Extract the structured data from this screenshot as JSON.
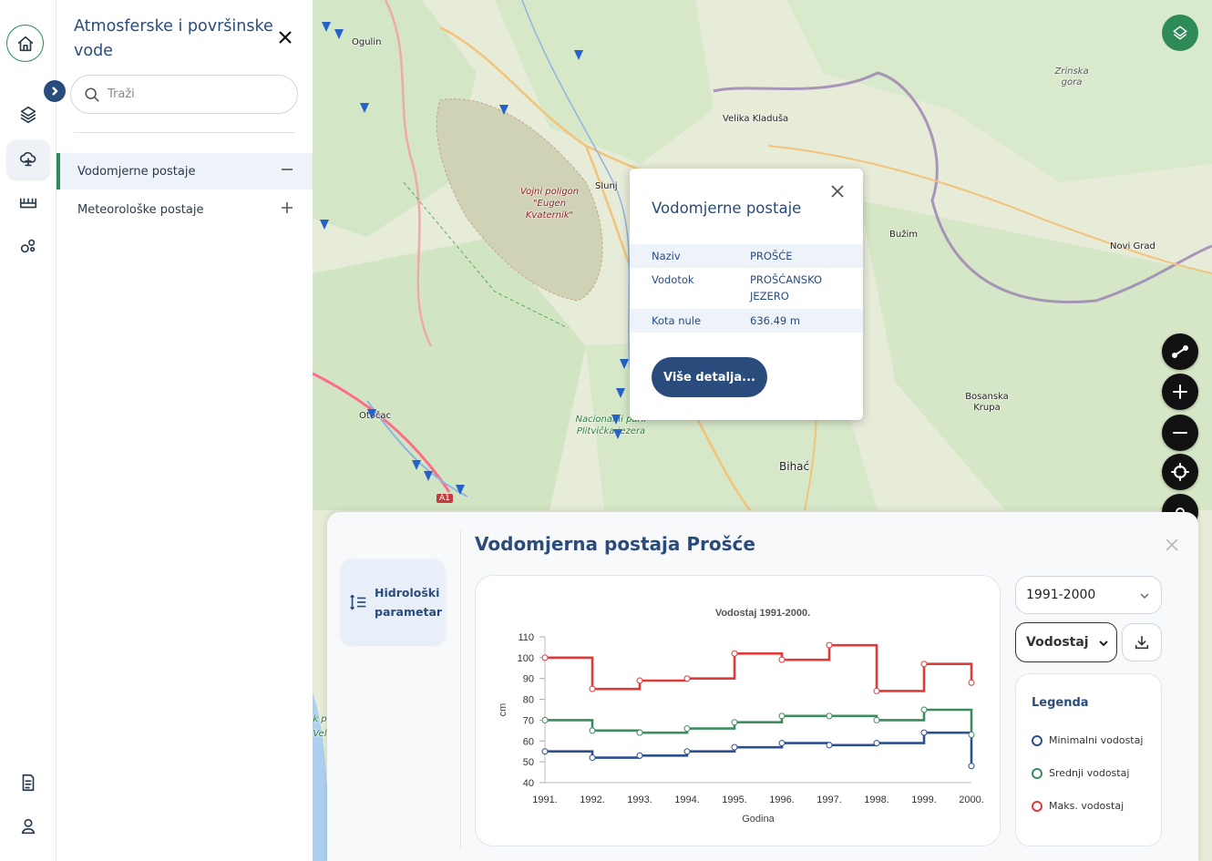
{
  "sidebar_rail": {
    "items": [
      "home-icon",
      "layers-icon",
      "weather-icon",
      "bridge-icon",
      "bubbles-icon",
      "document-icon",
      "user-icon"
    ]
  },
  "panel": {
    "title": "Atmosferske i površinske vode",
    "search_placeholder": "Traži",
    "categories": [
      {
        "label": "Vodomjerne postaje",
        "expanded": true
      },
      {
        "label": "Meteorološke postaje",
        "expanded": false
      }
    ]
  },
  "map": {
    "places": {
      "ogulin": "Ogulin",
      "velika_kladusa": "Velika Kladuša",
      "zrinska_gora": "Zrinska gora",
      "slunj": "Slunj",
      "vojni_poligon": "Vojni poligon \"Eugen Kvaternik\"",
      "buzim": "Bužim",
      "novi_grad": "Novi Grad",
      "bosanska_krupa": "Bosanska Krupa",
      "otocac": "Otočac",
      "plitvice": "Nacionalni park Plitvička jezera",
      "bihac": "Bihać",
      "a1": "A1",
      "edge_partial": "k p Vel"
    }
  },
  "popup": {
    "title": "Vodomjerne postaje",
    "rows": [
      {
        "label": "Naziv",
        "value": "PROŠĆE"
      },
      {
        "label": "Vodotok",
        "value": "PROŠĆANSKO JEZERO"
      },
      {
        "label": "Kota nule",
        "value": "636.49 m"
      }
    ],
    "button_label": "Više detalja..."
  },
  "chart_panel": {
    "title": "Vodomjerna postaja Prošće",
    "param_tab_label": "Hidrološki parametar",
    "period_value": "1991-2000",
    "parameter_value": "Vodostaj",
    "legend_title": "Legenda"
  },
  "chart_data": {
    "type": "line",
    "title": "Vodostaj 1991-2000.",
    "xlabel": "Godina",
    "ylabel": "cm",
    "x": [
      "1991.",
      "1992.",
      "1993.",
      "1994.",
      "1995.",
      "1996.",
      "1997.",
      "1998.",
      "1999.",
      "2000."
    ],
    "ylim": [
      40,
      110
    ],
    "yticks": [
      40,
      50,
      60,
      70,
      80,
      90,
      100,
      110
    ],
    "step": true,
    "series": [
      {
        "name": "Minimalni vodostaj",
        "color": "#2c4f8f",
        "values": [
          55,
          52,
          53,
          55,
          57,
          59,
          58,
          59,
          64,
          48
        ]
      },
      {
        "name": "Srednji vodostaj",
        "color": "#3d8b5f",
        "values": [
          70,
          65,
          64,
          66,
          69,
          72,
          72,
          70,
          75,
          63
        ]
      },
      {
        "name": "Maks. vodostaj",
        "color": "#e03b3b",
        "values": [
          100,
          85,
          89,
          90,
          102,
          99,
          106,
          84,
          97,
          88
        ]
      }
    ]
  }
}
